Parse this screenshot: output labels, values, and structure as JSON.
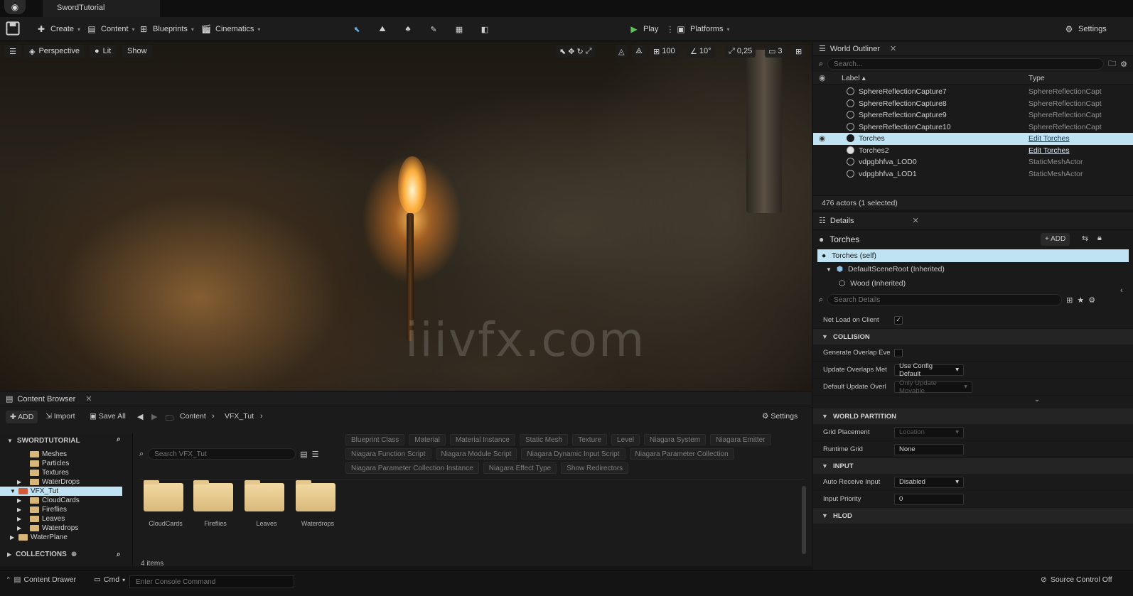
{
  "window": {
    "project_tab": "SwordTutorial"
  },
  "toolbar": {
    "create": "Create",
    "content": "Content",
    "blueprints": "Blueprints",
    "cinematics": "Cinematics",
    "play": "Play",
    "platforms": "Platforms",
    "settings": "Settings"
  },
  "viewport": {
    "perspective": "Perspective",
    "lit": "Lit",
    "show": "Show",
    "grid_snap": "100",
    "rotation_snap": "10°",
    "scale_snap": "0,25",
    "camera_speed": "3",
    "watermark": "iiivfx.com"
  },
  "outliner": {
    "title": "World Outliner",
    "search_placeholder": "Search...",
    "col_label": "Label ▴",
    "col_type": "Type",
    "rows": [
      {
        "label": "SphereReflectionCapture7",
        "type": "SphereReflectionCapt"
      },
      {
        "label": "SphereReflectionCapture8",
        "type": "SphereReflectionCapt"
      },
      {
        "label": "SphereReflectionCapture9",
        "type": "SphereReflectionCapt"
      },
      {
        "label": "SphereReflectionCapture10",
        "type": "SphereReflectionCapt"
      },
      {
        "label": "Torches",
        "type": "Edit Torches"
      },
      {
        "label": "Torches2",
        "type": "Edit Torches"
      },
      {
        "label": "vdpgbhfva_LOD0",
        "type": "StaticMeshActor"
      },
      {
        "label": "vdpgbhfva_LOD1",
        "type": "StaticMeshActor"
      }
    ],
    "status": "476 actors (1 selected)"
  },
  "details": {
    "title": "Details",
    "object_name": "Torches",
    "add_label": "+ ADD",
    "components": [
      "Torches (self)",
      "DefaultSceneRoot (Inherited)",
      "Wood (Inherited)"
    ],
    "search_placeholder": "Search Details",
    "net_load": "Net Load on Client",
    "sections": {
      "collision": "COLLISION",
      "world_partition": "WORLD PARTITION",
      "input": "INPUT",
      "hlod": "HLOD"
    },
    "props": {
      "generate_overlap": "Generate Overlap Eve",
      "update_overlaps": "Update Overlaps Met",
      "update_overlaps_value": "Use Config Default",
      "default_update": "Default Update Overl",
      "default_update_value": "Only Update Movable",
      "grid_placement": "Grid Placement",
      "grid_placement_value": "Location",
      "runtime_grid": "Runtime Grid",
      "runtime_grid_value": "None",
      "auto_receive": "Auto Receive Input",
      "auto_receive_value": "Disabled",
      "input_priority": "Input Priority",
      "input_priority_value": "0"
    }
  },
  "content_browser": {
    "title": "Content Browser",
    "add": "ADD",
    "import": "Import",
    "save_all": "Save All",
    "path": [
      "Content",
      "VFX_Tut"
    ],
    "settings": "Settings",
    "tree_root": "SWORDTUTORIAL",
    "tree": [
      {
        "name": "Meshes",
        "indent": 2
      },
      {
        "name": "Particles",
        "indent": 2
      },
      {
        "name": "Textures",
        "indent": 2
      },
      {
        "name": "WaterDrops",
        "indent": 2
      },
      {
        "name": "VFX_Tut",
        "indent": 1
      },
      {
        "name": "CloudCards",
        "indent": 2
      },
      {
        "name": "Fireflies",
        "indent": 2
      },
      {
        "name": "Leaves",
        "indent": 2
      },
      {
        "name": "Waterdrops",
        "indent": 2
      },
      {
        "name": "WaterPlane",
        "indent": 1
      }
    ],
    "collections": "COLLECTIONS",
    "search_placeholder": "Search VFX_Tut",
    "filters_row1": [
      "Blueprint Class",
      "Material",
      "Material Instance",
      "Static Mesh",
      "Texture",
      "Level",
      "Niagara System",
      "Niagara Emitter"
    ],
    "filters_row2": [
      "Niagara Function Script",
      "Niagara Module Script",
      "Niagara Dynamic Input Script",
      "Niagara Parameter Collection"
    ],
    "filters_row3": [
      "Niagara Parameter Collection Instance",
      "Niagara Effect Type",
      "Show Redirectors"
    ],
    "folders": [
      "CloudCards",
      "Fireflies",
      "Leaves",
      "Waterdrops"
    ],
    "item_count": "4 items"
  },
  "statusbar": {
    "content_drawer": "Content Drawer",
    "cmd": "Cmd",
    "console_placeholder": "Enter Console Command",
    "source_control": "Source Control Off"
  }
}
